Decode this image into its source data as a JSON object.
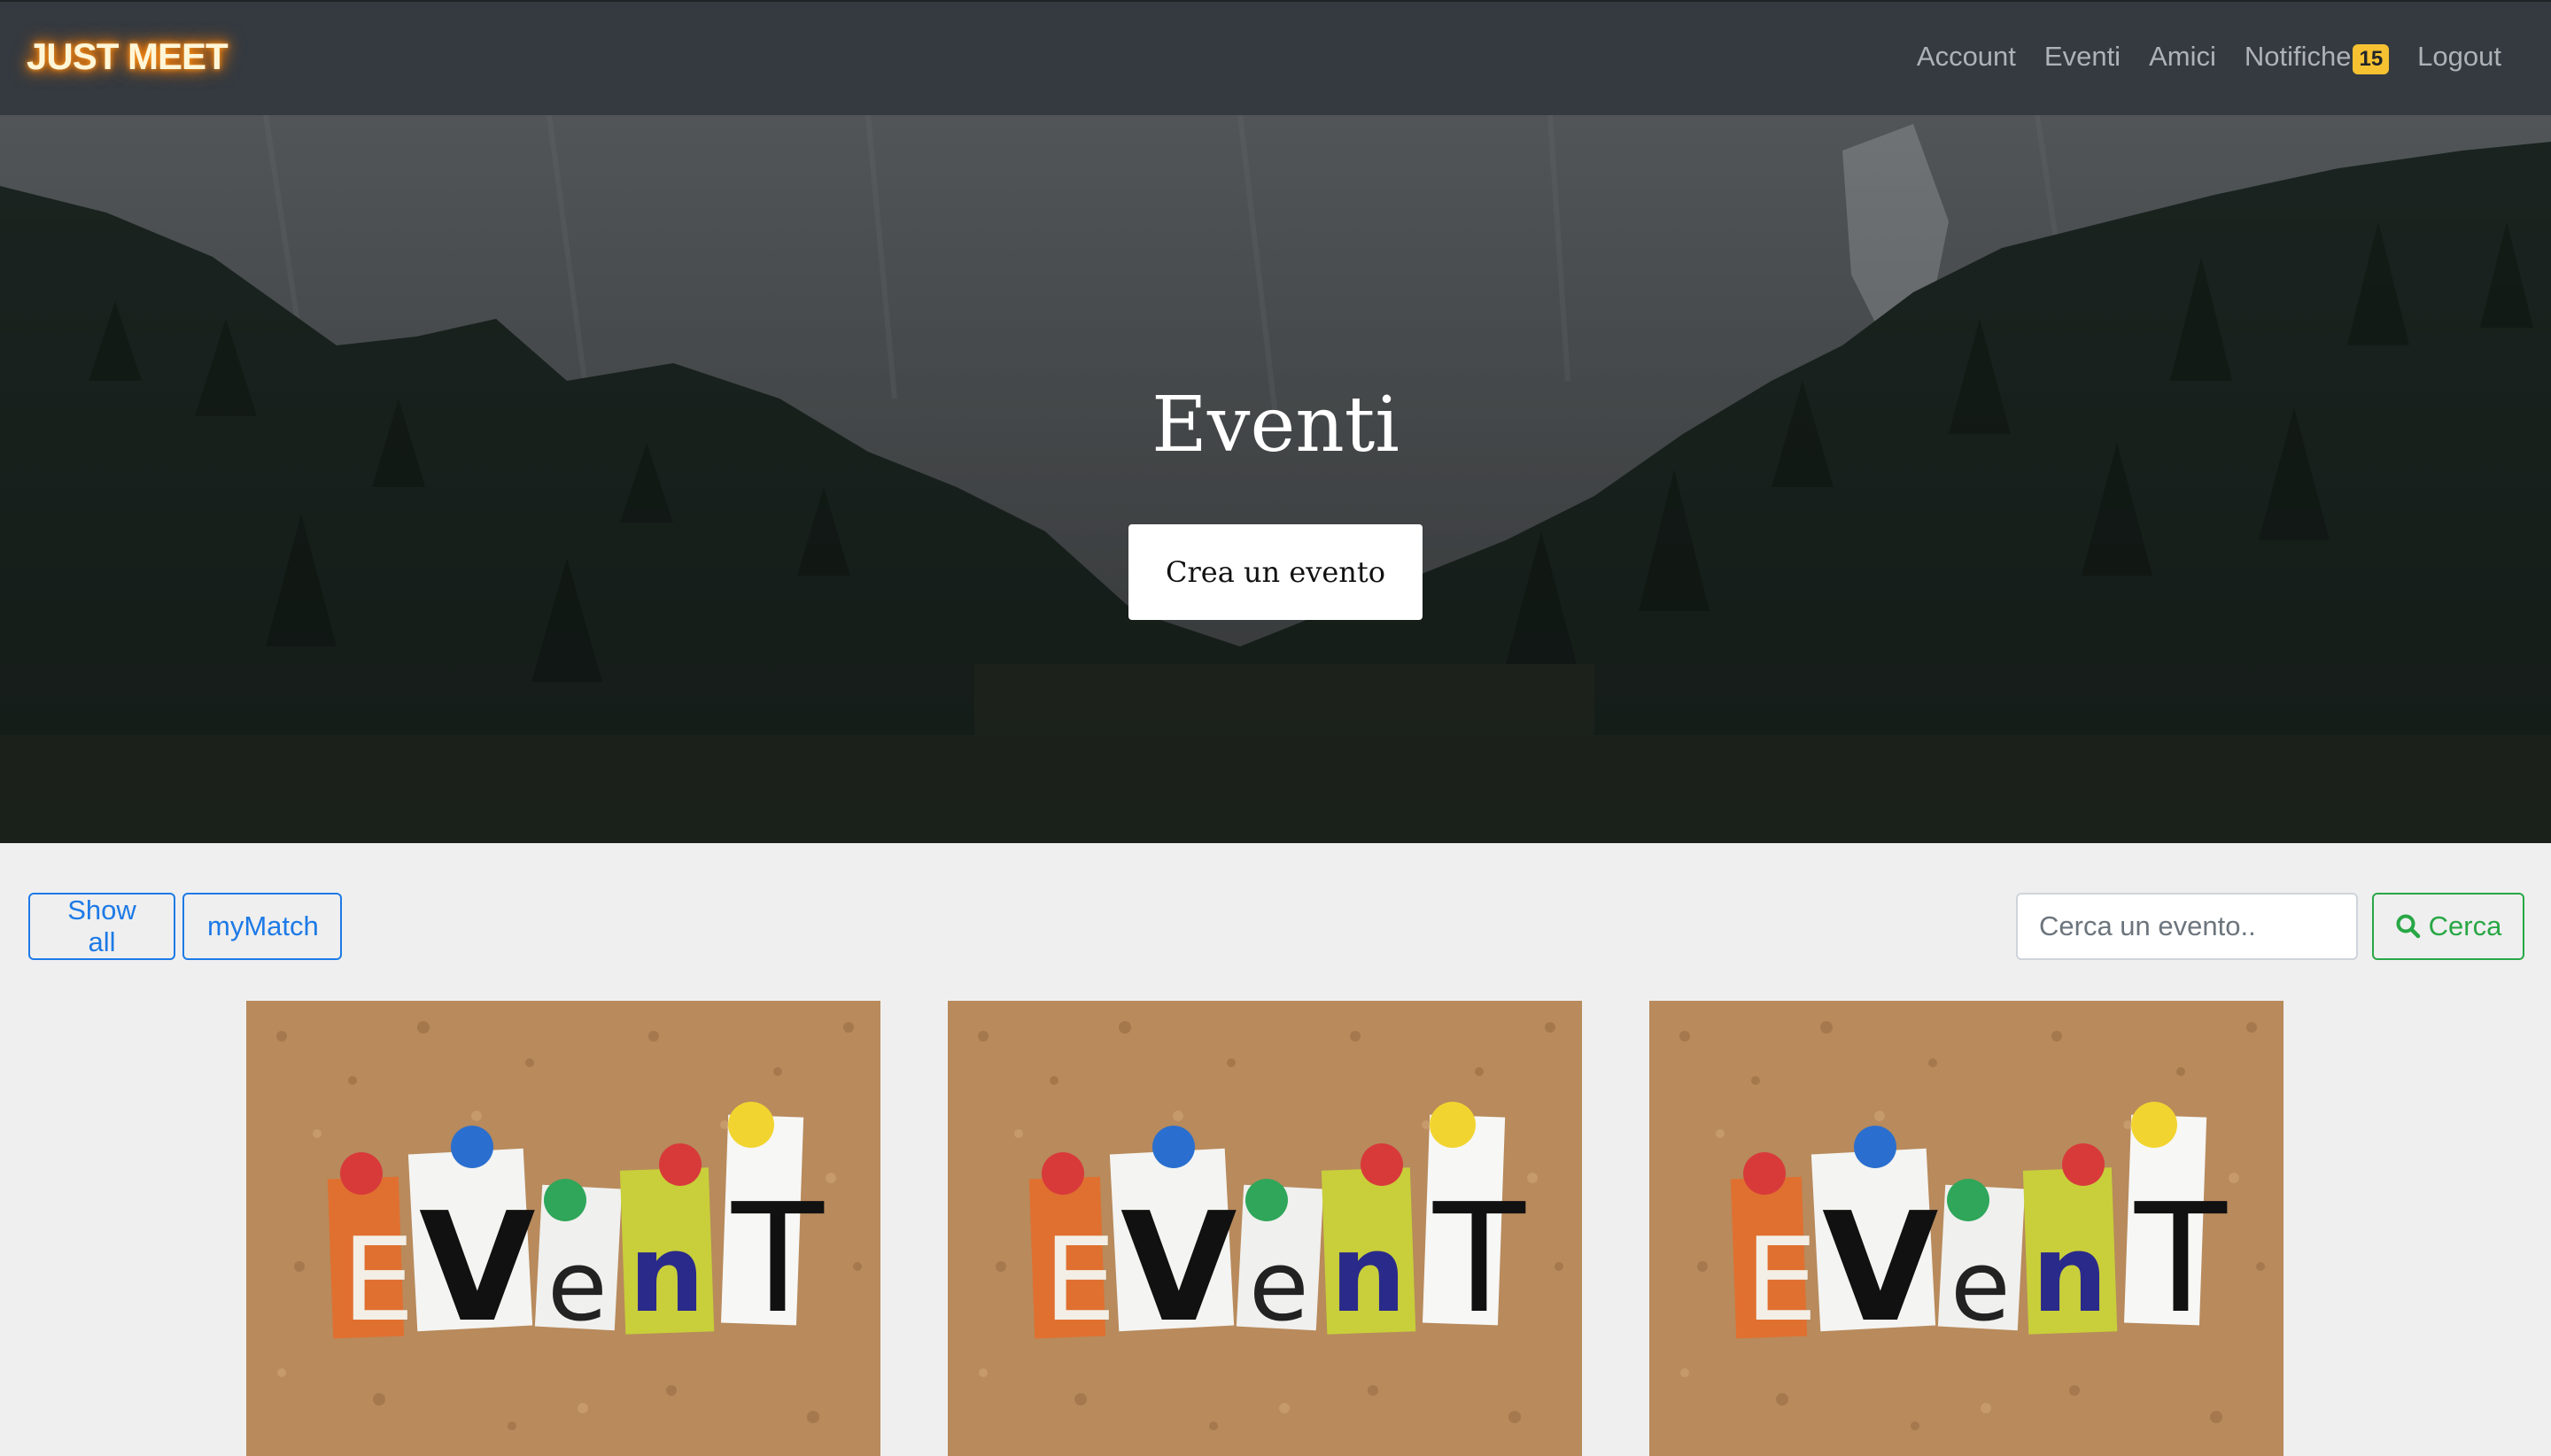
{
  "navbar": {
    "brand": "JUST MEET",
    "links": [
      {
        "label": "Account"
      },
      {
        "label": "Eventi"
      },
      {
        "label": "Amici"
      },
      {
        "label": "Notifiche",
        "badge": "15"
      },
      {
        "label": "Logout"
      }
    ]
  },
  "hero": {
    "title": "Eventi",
    "button_label": "Crea un evento"
  },
  "filters": {
    "show_all_label": "Show all",
    "mymatch_label": "myMatch",
    "search_placeholder": "Cerca un evento..",
    "search_button_label": "Cerca",
    "search_icon": "search-icon"
  },
  "cards": [
    {
      "image_text": "EVenT"
    },
    {
      "image_text": "EVenT"
    },
    {
      "image_text": "EVenT"
    }
  ],
  "colors": {
    "navbar_bg": "#343a40",
    "badge": "#f6c232",
    "primary_outline": "#1d7ae6",
    "success_outline": "#28a745",
    "page_bg": "#efefef"
  }
}
